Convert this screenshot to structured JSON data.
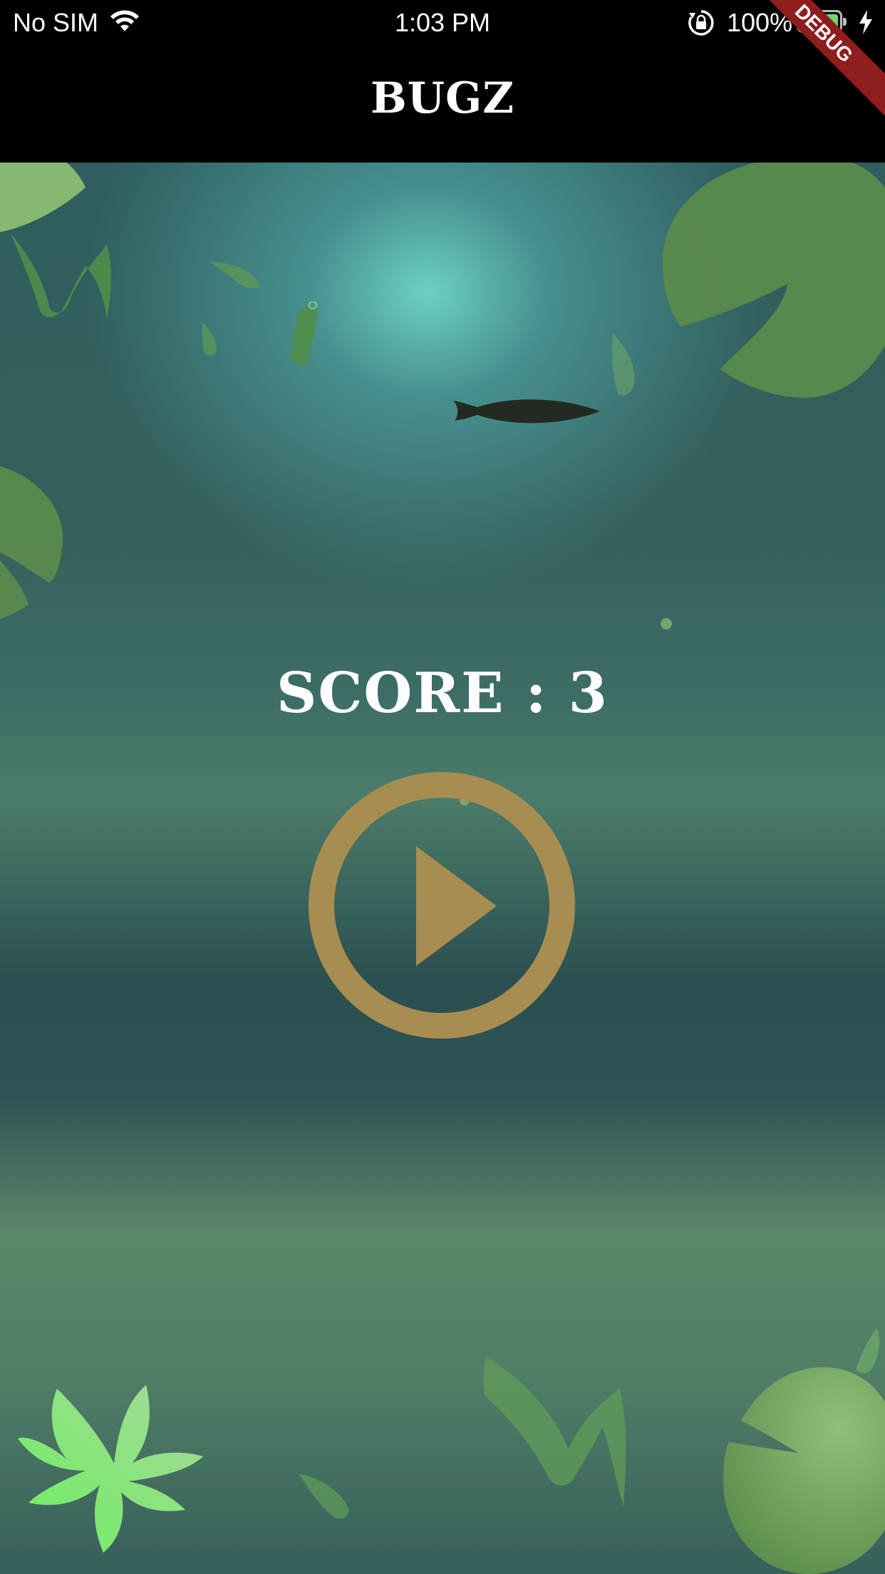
{
  "status_bar": {
    "carrier": "No SIM",
    "time": "1:03 PM",
    "battery_percent": "100%",
    "battery_level": 1.0,
    "battery_color": "#6fdc6f"
  },
  "app_bar": {
    "title": "BUGZ",
    "debug_banner": "DEBUG"
  },
  "game": {
    "score_text": "SCORE : 3",
    "play_icon": "play-circle-icon",
    "play_color": "#a88d50"
  }
}
